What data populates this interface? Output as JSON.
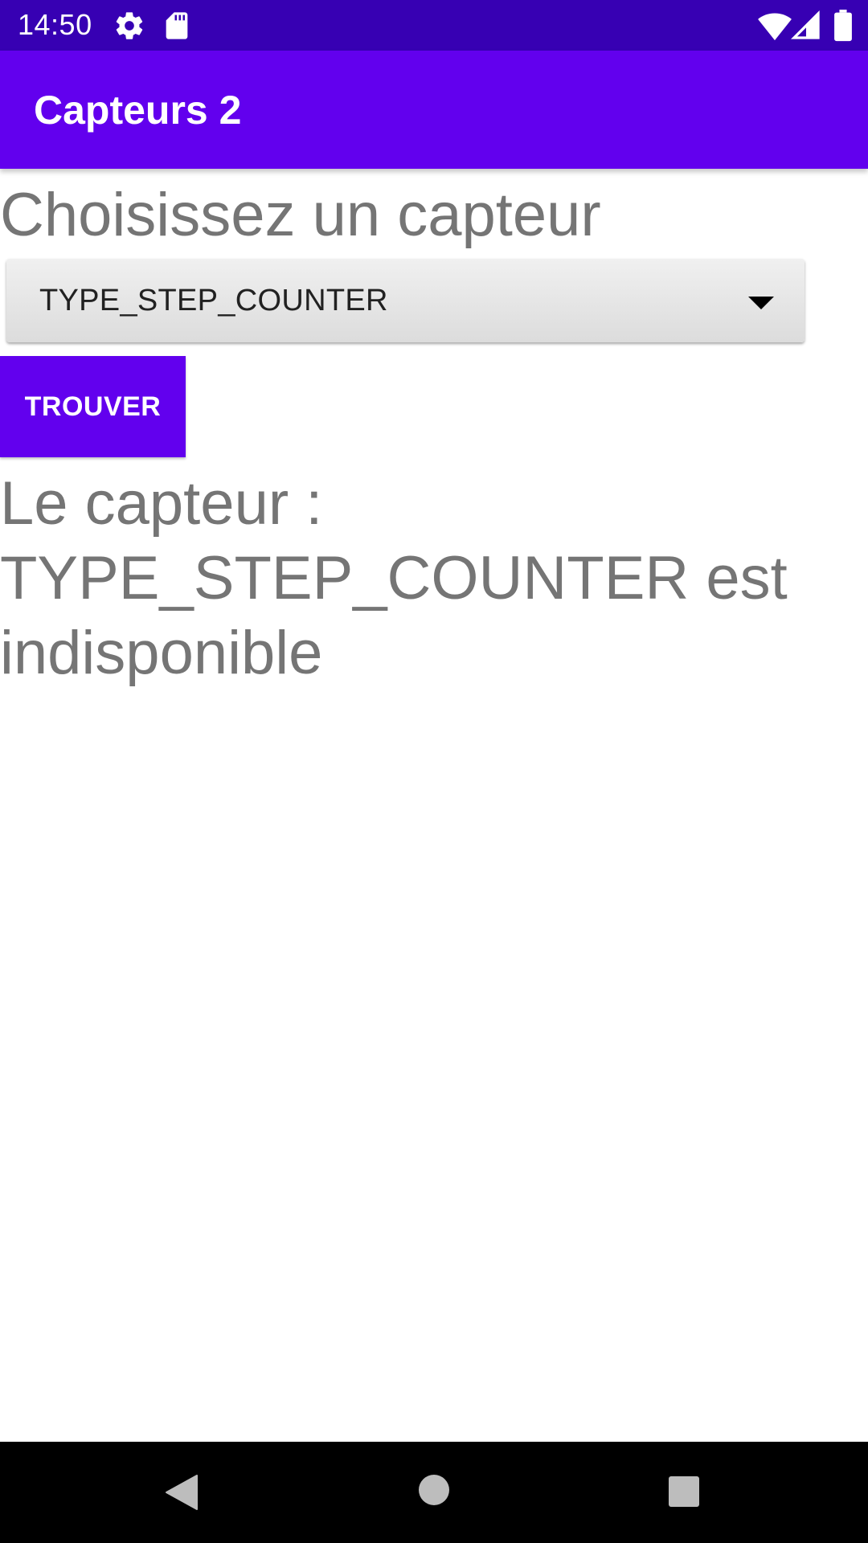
{
  "status_bar": {
    "time": "14:50",
    "icons": [
      "settings-icon",
      "sd-card-icon",
      "wifi-icon",
      "signal-icon",
      "battery-icon"
    ]
  },
  "app_bar": {
    "title": "Capteurs 2"
  },
  "main": {
    "prompt_label": "Choisissez un capteur",
    "sensor_select": {
      "selected_value": "TYPE_STEP_COUNTER"
    },
    "find_button_label": "TROUVER",
    "result_text": "Le capteur : TYPE_STEP_COUNTER est indisponible"
  },
  "nav_bar": {
    "buttons": [
      "back-icon",
      "home-icon",
      "recents-icon"
    ]
  },
  "colors": {
    "status_bar": "#3700B3",
    "primary": "#6200EE",
    "text_gray": "#757575"
  }
}
